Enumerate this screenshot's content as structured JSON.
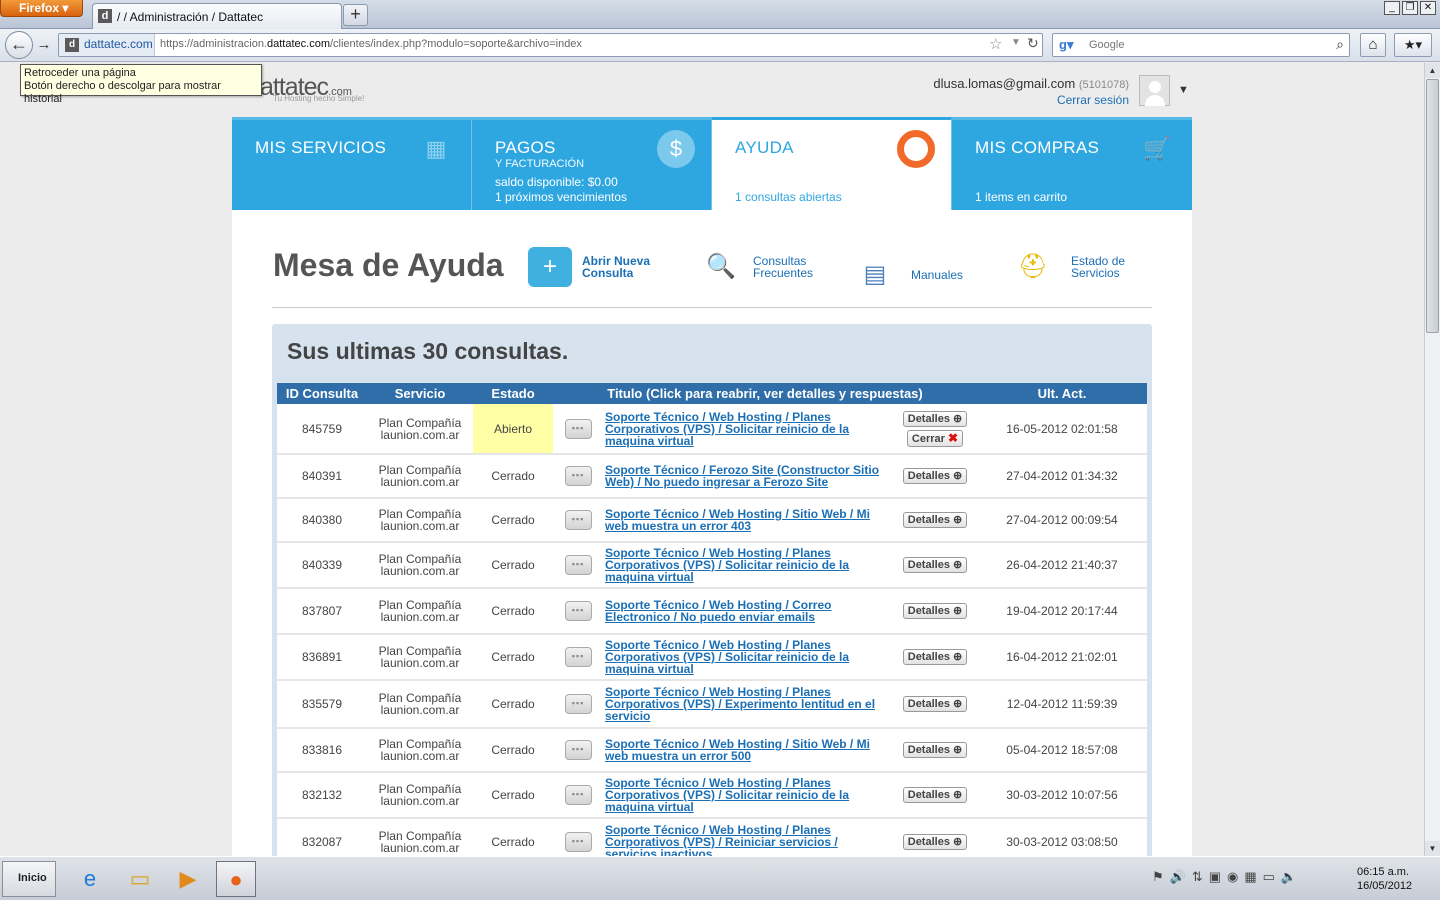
{
  "browser": {
    "menu_label": "Firefox",
    "tab_title": "/ / Administración / Dattatec",
    "site_identity": "dattatec.com",
    "url_prefix": "https://administracion.",
    "url_host": "dattatec.com",
    "url_path": "/clientes/index.php?modulo=soporte&archivo=index",
    "search_placeholder": "Google",
    "tooltip_line1": "Retroceder una página",
    "tooltip_line2": "Botón derecho o descolgar para mostrar historial"
  },
  "header": {
    "logo_text": "attatec",
    "logo_com": ".com",
    "logo_tagline": "Tu Hosting hecho Simple!",
    "user_email": "dlusa.lomas@gmail.com",
    "user_id": "(5101078)",
    "logout_label": "Cerrar sesión"
  },
  "nav_tabs": [
    {
      "title": "MIS SERVICIOS",
      "subtitle": "",
      "info1": "",
      "info2": "",
      "active": false
    },
    {
      "title": "PAGOS",
      "subtitle": "Y FACTURACIÓN",
      "info1": "saldo disponible: $0.00",
      "info2": "1 próximos vencimientos",
      "active": false
    },
    {
      "title": "AYUDA",
      "subtitle": "",
      "info1": "1 consultas abiertas",
      "info2": "",
      "active": true
    },
    {
      "title": "MIS COMPRAS",
      "subtitle": "",
      "info1": "1 items en carrito",
      "info2": "",
      "active": false
    }
  ],
  "main": {
    "title": "Mesa de Ayuda",
    "quick_links": {
      "nueva_1": "Abrir Nueva",
      "nueva_2": "Consulta",
      "faq_1": "Consultas",
      "faq_2": "Frecuentes",
      "manuales": "Manuales",
      "estado_1": "Estado de",
      "estado_2": "Servicios"
    },
    "list_title": "Sus ultimas 30 consultas."
  },
  "table": {
    "headers": [
      "ID Consulta",
      "Servicio",
      "Estado",
      "Titulo (Click para reabrir, ver detalles y respuestas)",
      "Ult. Act."
    ],
    "detalles_label": "Detalles",
    "cerrar_label": "Cerrar",
    "rows": [
      {
        "id": "845759",
        "svc1": "Plan Compañía",
        "svc2": "launion.com.ar",
        "estado": "Abierto",
        "titulo": "Soporte Técnico / Web Hosting / Planes Corporativos (VPS) / Solicitar reinicio de la maquina virtual",
        "fecha": "16-05-2012 02:01:58"
      },
      {
        "id": "840391",
        "svc1": "Plan Compañía",
        "svc2": "launion.com.ar",
        "estado": "Cerrado",
        "titulo": "Soporte Técnico / Ferozo Site (Constructor Sitio Web) / No puedo ingresar a Ferozo Site",
        "fecha": "27-04-2012 01:34:32"
      },
      {
        "id": "840380",
        "svc1": "Plan Compañía",
        "svc2": "launion.com.ar",
        "estado": "Cerrado",
        "titulo": "Soporte Técnico / Web Hosting / Sitio Web / Mi web muestra un error 403",
        "fecha": "27-04-2012 00:09:54"
      },
      {
        "id": "840339",
        "svc1": "Plan Compañía",
        "svc2": "launion.com.ar",
        "estado": "Cerrado",
        "titulo": "Soporte Técnico / Web Hosting / Planes Corporativos (VPS) / Solicitar reinicio de la maquina virtual",
        "fecha": "26-04-2012 21:40:37"
      },
      {
        "id": "837807",
        "svc1": "Plan Compañía",
        "svc2": "launion.com.ar",
        "estado": "Cerrado",
        "titulo": "Soporte Técnico / Web Hosting / Correo Electronico / No puedo enviar emails",
        "fecha": "19-04-2012 20:17:44"
      },
      {
        "id": "836891",
        "svc1": "Plan Compañía",
        "svc2": "launion.com.ar",
        "estado": "Cerrado",
        "titulo": "Soporte Técnico / Web Hosting / Planes Corporativos (VPS) / Solicitar reinicio de la maquina virtual",
        "fecha": "16-04-2012 21:02:01"
      },
      {
        "id": "835579",
        "svc1": "Plan Compañía",
        "svc2": "launion.com.ar",
        "estado": "Cerrado",
        "titulo": "Soporte Técnico / Web Hosting / Planes Corporativos (VPS) / Experimento lentitud en el servicio",
        "fecha": "12-04-2012 11:59:39"
      },
      {
        "id": "833816",
        "svc1": "Plan Compañía",
        "svc2": "launion.com.ar",
        "estado": "Cerrado",
        "titulo": "Soporte Técnico / Web Hosting / Sitio Web / Mi web muestra un error 500",
        "fecha": "05-04-2012 18:57:08"
      },
      {
        "id": "832132",
        "svc1": "Plan Compañía",
        "svc2": "launion.com.ar",
        "estado": "Cerrado",
        "titulo": "Soporte Técnico / Web Hosting / Planes Corporativos (VPS) / Solicitar reinicio de la maquina virtual",
        "fecha": "30-03-2012 10:07:56"
      },
      {
        "id": "832087",
        "svc1": "Plan Compañía",
        "svc2": "launion.com.ar",
        "estado": "Cerrado",
        "titulo": "Soporte Técnico / Web Hosting / Planes Corporativos (VPS) / Reiniciar servicios / servicios inactivos",
        "fecha": "30-03-2012 03:08:50"
      }
    ]
  },
  "taskbar": {
    "start_label": "Inicio",
    "time": "06:15 a.m.",
    "date": "16/05/2012"
  },
  "colors": {
    "brand_blue": "#2ea7e0",
    "table_header": "#2f6ea8",
    "open_highlight": "#ffffa6",
    "link": "#1b6fb5"
  }
}
